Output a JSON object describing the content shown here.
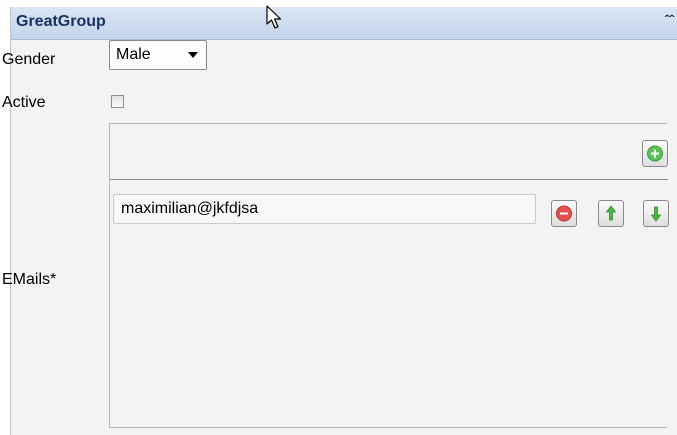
{
  "group": {
    "title": "GreatGroup"
  },
  "fields": {
    "gender": {
      "label": "Gender",
      "value": "Male"
    },
    "active": {
      "label": "Active",
      "checked": false
    },
    "emails": {
      "label": "EMails*",
      "items": [
        {
          "value": "maximilian@jkfdjsa"
        }
      ]
    }
  },
  "icons": {
    "collapse": "double-chevron-up-icon",
    "add": "add-icon",
    "remove": "remove-icon",
    "move_up": "arrow-up-icon",
    "move_down": "arrow-down-icon",
    "cursor": "mouse-pointer-icon"
  },
  "colors": {
    "add": "#5cc05a",
    "remove": "#e2504f",
    "arrows": "#52b44a",
    "header": "#c9d8ec"
  }
}
